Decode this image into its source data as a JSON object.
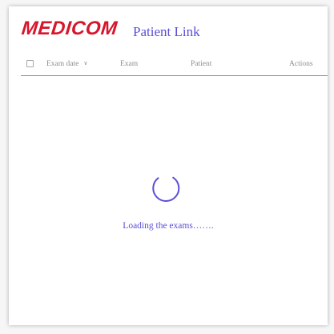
{
  "header": {
    "logo_text": "MEDICOM",
    "app_title": "Patient Link"
  },
  "table": {
    "columns": {
      "exam_date": "Exam date",
      "exam": "Exam",
      "patient": "Patient",
      "actions": "Actions"
    },
    "sort_icon": "chevron-down-icon"
  },
  "loading": {
    "text": "Loading the exams……."
  },
  "colors": {
    "brand_red": "#d7152b",
    "accent": "#5a4fd6"
  }
}
